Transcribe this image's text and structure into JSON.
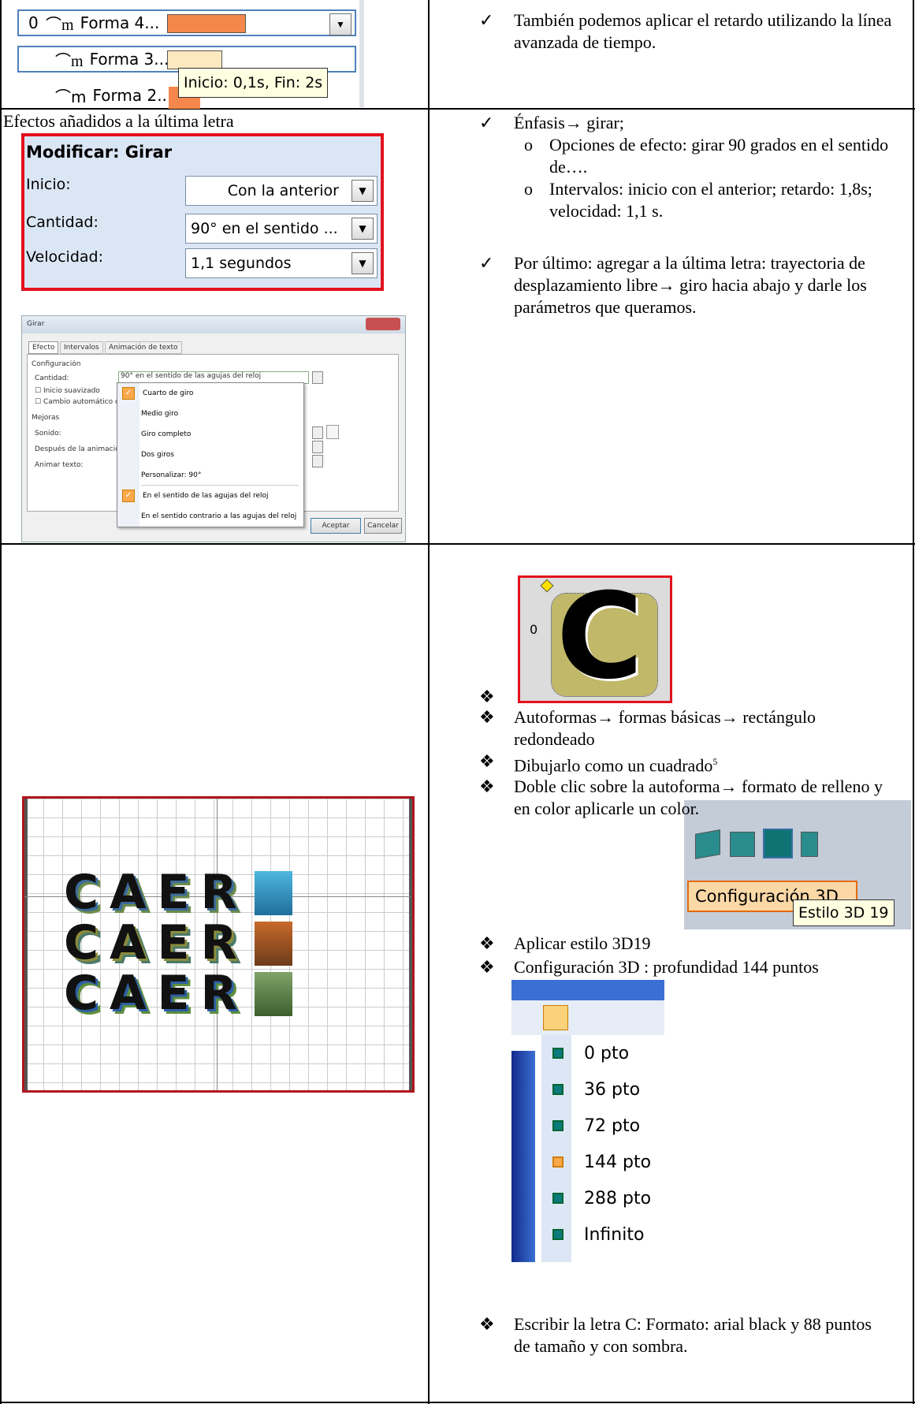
{
  "anim_list": {
    "rows": [
      {
        "num": "0",
        "label": "Forma 4...",
        "color": "#f4874b"
      },
      {
        "num": "",
        "label": "Forma 3...",
        "color": "#fde9c0"
      },
      {
        "num": "",
        "label": "Forma 2...",
        "color": "#f4874b"
      }
    ],
    "tooltip": "Inicio: 0,1s, Fin: 2s"
  },
  "row1": {
    "bullet": "✓",
    "text": "También podemos aplicar el retardo utilizando la línea avanzada de tiempo."
  },
  "row2": {
    "caption": "Efectos añadidos a la última letra",
    "modify_panel": {
      "title": "Modificar: Girar",
      "inicio_label": "Inicio:",
      "inicio_value": "Con la anterior",
      "cantidad_label": "Cantidad:",
      "cantidad_value": "90° en el sentido ...",
      "velocidad_label": "Velocidad:",
      "velocidad_value": "1,1 segundos"
    },
    "dialog": {
      "title": "Girar",
      "tabs": [
        "Efecto",
        "Intervalos",
        "Animación de texto"
      ],
      "section_config": "Configuración",
      "cantidad_label": "Cantidad:",
      "cantidad_value": "90° en el sentido de las agujas del reloj",
      "inicio_suavizado": "Inicio suavizado",
      "cambio_auto": "Cambio automático de d",
      "section_mejoras": "Mejoras",
      "sonido": "Sonido:",
      "despues": "Después de la animación:",
      "animar": "Animar texto:",
      "menu": [
        "Cuarto de giro",
        "Medio giro",
        "Giro completo",
        "Dos giros",
        "Personalizar:  90°",
        "En el sentido de las agujas del reloj",
        "En el sentido contrario a las agujas del reloj"
      ],
      "ok": "Aceptar",
      "cancel": "Cancelar"
    },
    "bullets": [
      {
        "sym": "✓",
        "text": "Énfasis→ girar;"
      },
      {
        "sym": "o",
        "text": "Opciones de efecto: girar 90 grados en el sentido de…."
      },
      {
        "sym": "o",
        "text": "Intervalos: inicio con el anterior; retardo: 1,8s; velocidad: 1,1 s."
      },
      {
        "sym": "✓",
        "text": "Por último: agregar a la última letra: trayectoria de desplazamiento libre→ giro hacia abajo y darle los parámetros que queramos."
      }
    ]
  },
  "row3": {
    "slide_words": [
      "CAER",
      "CAER",
      "CAER"
    ],
    "shape_letter": "C",
    "shape_num": "0",
    "bullets": [
      {
        "sym": "❖",
        "text": "Autoformas→ formas básicas→ rectángulo redondeado"
      },
      {
        "sym": "❖",
        "text": "Dibujarlo como un cuadrado",
        "sup": "5"
      },
      {
        "sym": "❖",
        "text": "Doble clic sobre la autoforma→ formato de relleno y en color aplicarle un color."
      },
      {
        "sym": "❖",
        "text": "Aplicar estilo 3D19"
      },
      {
        "sym": "❖",
        "text": "Configuración 3D : profundidad 144 puntos"
      },
      {
        "sym": "❖",
        "text": "Escribir la letra C: Formato: arial black y 88 puntos de tamaño y con sombra."
      }
    ],
    "config3d_label": "Configuración 3D",
    "style_tooltip": "Estilo 3D 19",
    "depth_options": [
      "0 pto",
      "36 pto",
      "72 pto",
      "144 pto",
      "288 pto",
      "Infinito"
    ],
    "depth_selected": "144 pto"
  }
}
